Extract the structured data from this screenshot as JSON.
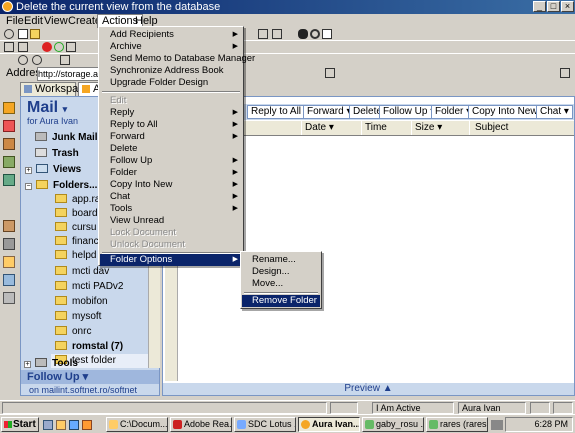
{
  "window": {
    "title": "Delete the current view from the database",
    "controls": [
      "_",
      "□",
      "×"
    ]
  },
  "menubar": {
    "items": [
      "File",
      "Edit",
      "View",
      "Create",
      "Actions",
      "Help"
    ]
  },
  "address": {
    "label": "Address",
    "value": "http://storage.ads"
  },
  "tabs": [
    {
      "label": "Workspace",
      "icon": "workspace-icon"
    },
    {
      "label": "A",
      "icon": "mail-tab-icon"
    }
  ],
  "mail": {
    "title": "Mail",
    "title_arrow": "▾",
    "subtitle": "for Aura Ivan",
    "nav": [
      {
        "label": "Junk Mail",
        "icon": "junk-mail-icon"
      },
      {
        "label": "Trash",
        "icon": "trash-icon"
      },
      {
        "label": "Views",
        "icon": "views-icon",
        "expander": "+"
      },
      {
        "label": "Folders...",
        "icon": "folders-icon",
        "expander": "−"
      }
    ],
    "folders": [
      {
        "label": "app.ra",
        "bold": false
      },
      {
        "label": "board",
        "bold": false
      },
      {
        "label": "cursu",
        "bold": false
      },
      {
        "label": "financ",
        "bold": false
      },
      {
        "label": "helpd",
        "bold": false
      },
      {
        "label": "mcti dav",
        "bold": false
      },
      {
        "label": "mcti PADv2",
        "bold": false
      },
      {
        "label": "mobifon",
        "bold": false
      },
      {
        "label": "mysoft",
        "bold": false
      },
      {
        "label": "onrc",
        "bold": false
      },
      {
        "label": "romstal (7)",
        "bold": true
      },
      {
        "label": "test folder",
        "bold": false,
        "selected": true
      }
    ],
    "tools": {
      "label": "Tools",
      "expander": "+"
    },
    "followup": "Follow Up ▾",
    "footer": "on mailint.softnet.ro/softnet"
  },
  "action_bar": {
    "buttons": [
      "Reply to All ▾",
      "Forward ▾",
      "Delete",
      "Follow Up ▾",
      "Folder ▾",
      "Copy Into New ▾",
      "Chat ▾"
    ]
  },
  "columns": [
    "Date ▾",
    "Time",
    "Size ▾",
    "Subject"
  ],
  "preview": "Preview ▲",
  "actions_menu": {
    "items": [
      {
        "label": "Add Recipients",
        "submenu": true,
        "disabled": false
      },
      {
        "label": "Archive",
        "submenu": true,
        "disabled": false
      },
      {
        "label": "Send Memo to Database Manager",
        "submenu": false,
        "disabled": false
      },
      {
        "label": "Synchronize Address Book",
        "submenu": false,
        "disabled": false
      },
      {
        "label": "Upgrade Folder Design",
        "submenu": false,
        "disabled": false
      },
      {
        "label": "Edit",
        "submenu": false,
        "disabled": true
      },
      {
        "label": "Reply",
        "submenu": true,
        "disabled": false
      },
      {
        "label": "Reply to All",
        "submenu": true,
        "disabled": false
      },
      {
        "label": "Forward",
        "submenu": true,
        "disabled": false
      },
      {
        "label": "Delete",
        "submenu": false,
        "disabled": false
      },
      {
        "label": "Follow Up",
        "submenu": true,
        "disabled": false
      },
      {
        "label": "Folder",
        "submenu": true,
        "disabled": false
      },
      {
        "label": "Copy Into New",
        "submenu": true,
        "disabled": false
      },
      {
        "label": "Chat",
        "submenu": true,
        "disabled": false
      },
      {
        "label": "Tools",
        "submenu": true,
        "disabled": false
      },
      {
        "label": "View Unread",
        "submenu": false,
        "disabled": false
      },
      {
        "label": "Lock Document",
        "submenu": false,
        "disabled": true
      },
      {
        "label": "Unlock Document",
        "submenu": false,
        "disabled": true
      },
      {
        "label": "Folder Options",
        "submenu": true,
        "disabled": false,
        "highlighted": true
      }
    ]
  },
  "folder_options_menu": {
    "items": [
      {
        "label": "Rename...",
        "highlighted": false
      },
      {
        "label": "Design...",
        "highlighted": false
      },
      {
        "label": "Move...",
        "highlighted": false
      },
      {
        "label": "Remove Folder",
        "highlighted": true
      }
    ]
  },
  "status_bar": {
    "status": "I Am Active",
    "user": "Aura Ivan"
  },
  "taskbar": {
    "start": "Start",
    "tasks": [
      {
        "label": "C:\\Docum...",
        "icon": "folder-icon"
      },
      {
        "label": "Adobe Rea...",
        "icon": "adobe-reader-icon"
      },
      {
        "label": "SDC Lotus ...",
        "icon": "document-icon"
      },
      {
        "label": "Aura Ivan...",
        "icon": "lotus-notes-icon",
        "active": true
      },
      {
        "label": "gaby_rosu ...",
        "icon": "chat-icon"
      },
      {
        "label": "rares (rares...",
        "icon": "chat-icon"
      }
    ],
    "clock": "6:28 PM"
  },
  "colors": {
    "titlebar": "#0a246a",
    "menu_highlight": "#0a246a",
    "nav_background": "#c9d8ec",
    "mail_title": "#1f3f8c"
  }
}
